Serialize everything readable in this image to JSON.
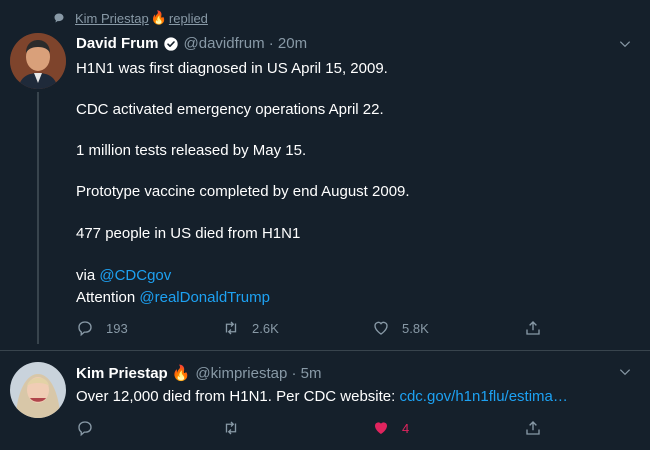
{
  "context": {
    "name": "Kim Priestap",
    "emoji": "🔥",
    "action": "replied"
  },
  "tweet1": {
    "display_name": "David Frum",
    "handle_time": "@davidfrum · 20m",
    "lines": [
      "H1N1 was first diagnosed in US April 15, 2009.",
      "CDC activated emergency operations April 22.",
      "1 million tests released by May 15.",
      "Prototype vaccine completed by end August 2009.",
      "477 people in US died from H1N1"
    ],
    "via_prefix": "via ",
    "via_link": "@CDCgov",
    "attention_prefix": "Attention ",
    "attention_link": "@realDonaldTrump",
    "replies": "193",
    "retweets": "2.6K",
    "likes": "5.8K"
  },
  "tweet2": {
    "display_name": "Kim Priestap",
    "emoji": "🔥",
    "handle_time": "@kimpriestap · 5m",
    "text": "Over 12,000 died from H1N1. Per CDC website: ",
    "link": "cdc.gov/h1n1flu/estima…",
    "replies": "",
    "retweets": "",
    "likes": "4",
    "liked_color": "#e0245e"
  }
}
